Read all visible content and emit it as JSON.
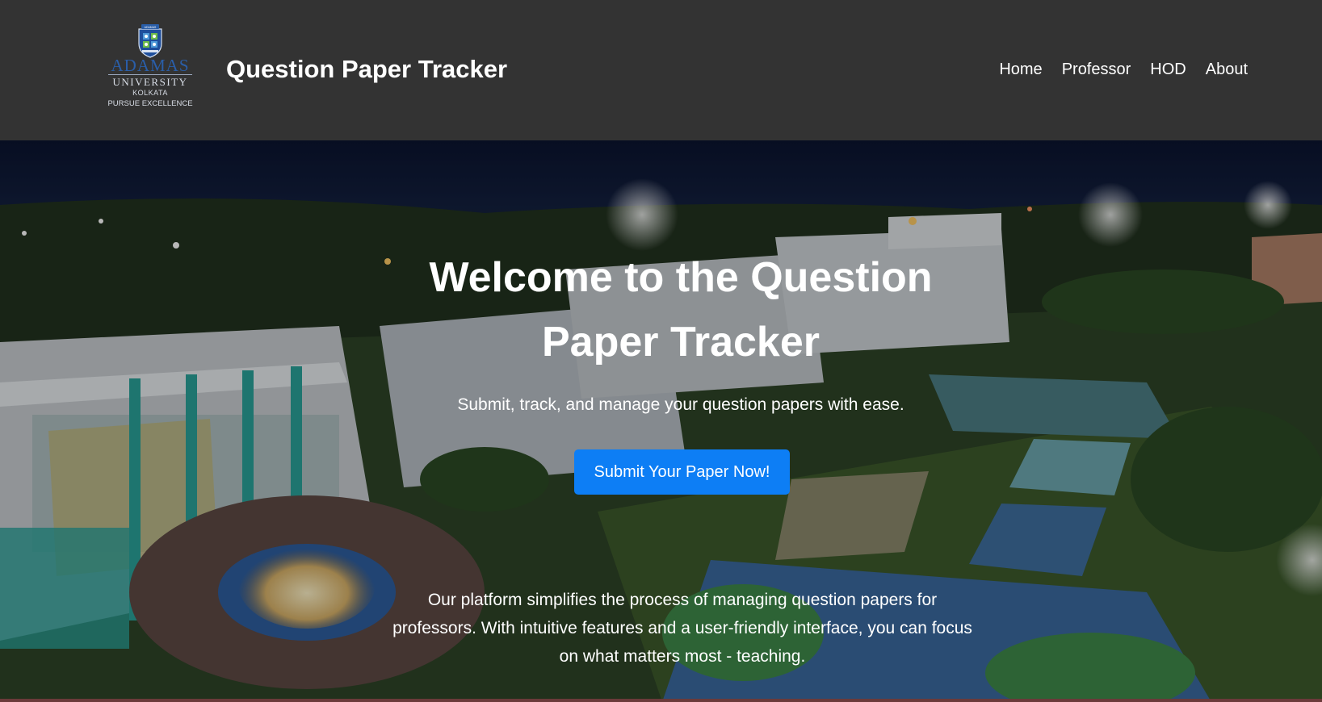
{
  "header": {
    "logo": {
      "name": "ADAMAS",
      "university": "UNIVERSITY",
      "city": "KOLKATA",
      "motto": "PURSUE EXCELLENCE",
      "crest_text": "ADAMAS"
    },
    "title": "Question Paper Tracker",
    "nav": [
      "Home",
      "Professor",
      "HOD",
      "About"
    ]
  },
  "hero": {
    "title": "Welcome to the Question Paper Tracker",
    "subtitle": "Submit, track, and manage your question papers with ease.",
    "cta_label": "Submit Your Paper Now!",
    "description": "Our platform simplifies the process of managing question papers for professors. With intuitive features and a user-friendly interface, you can focus on what matters most - teaching."
  },
  "colors": {
    "header_bg": "#333333",
    "cta_bg": "#0d7ef5",
    "logo_blue": "#2a5ea8"
  }
}
